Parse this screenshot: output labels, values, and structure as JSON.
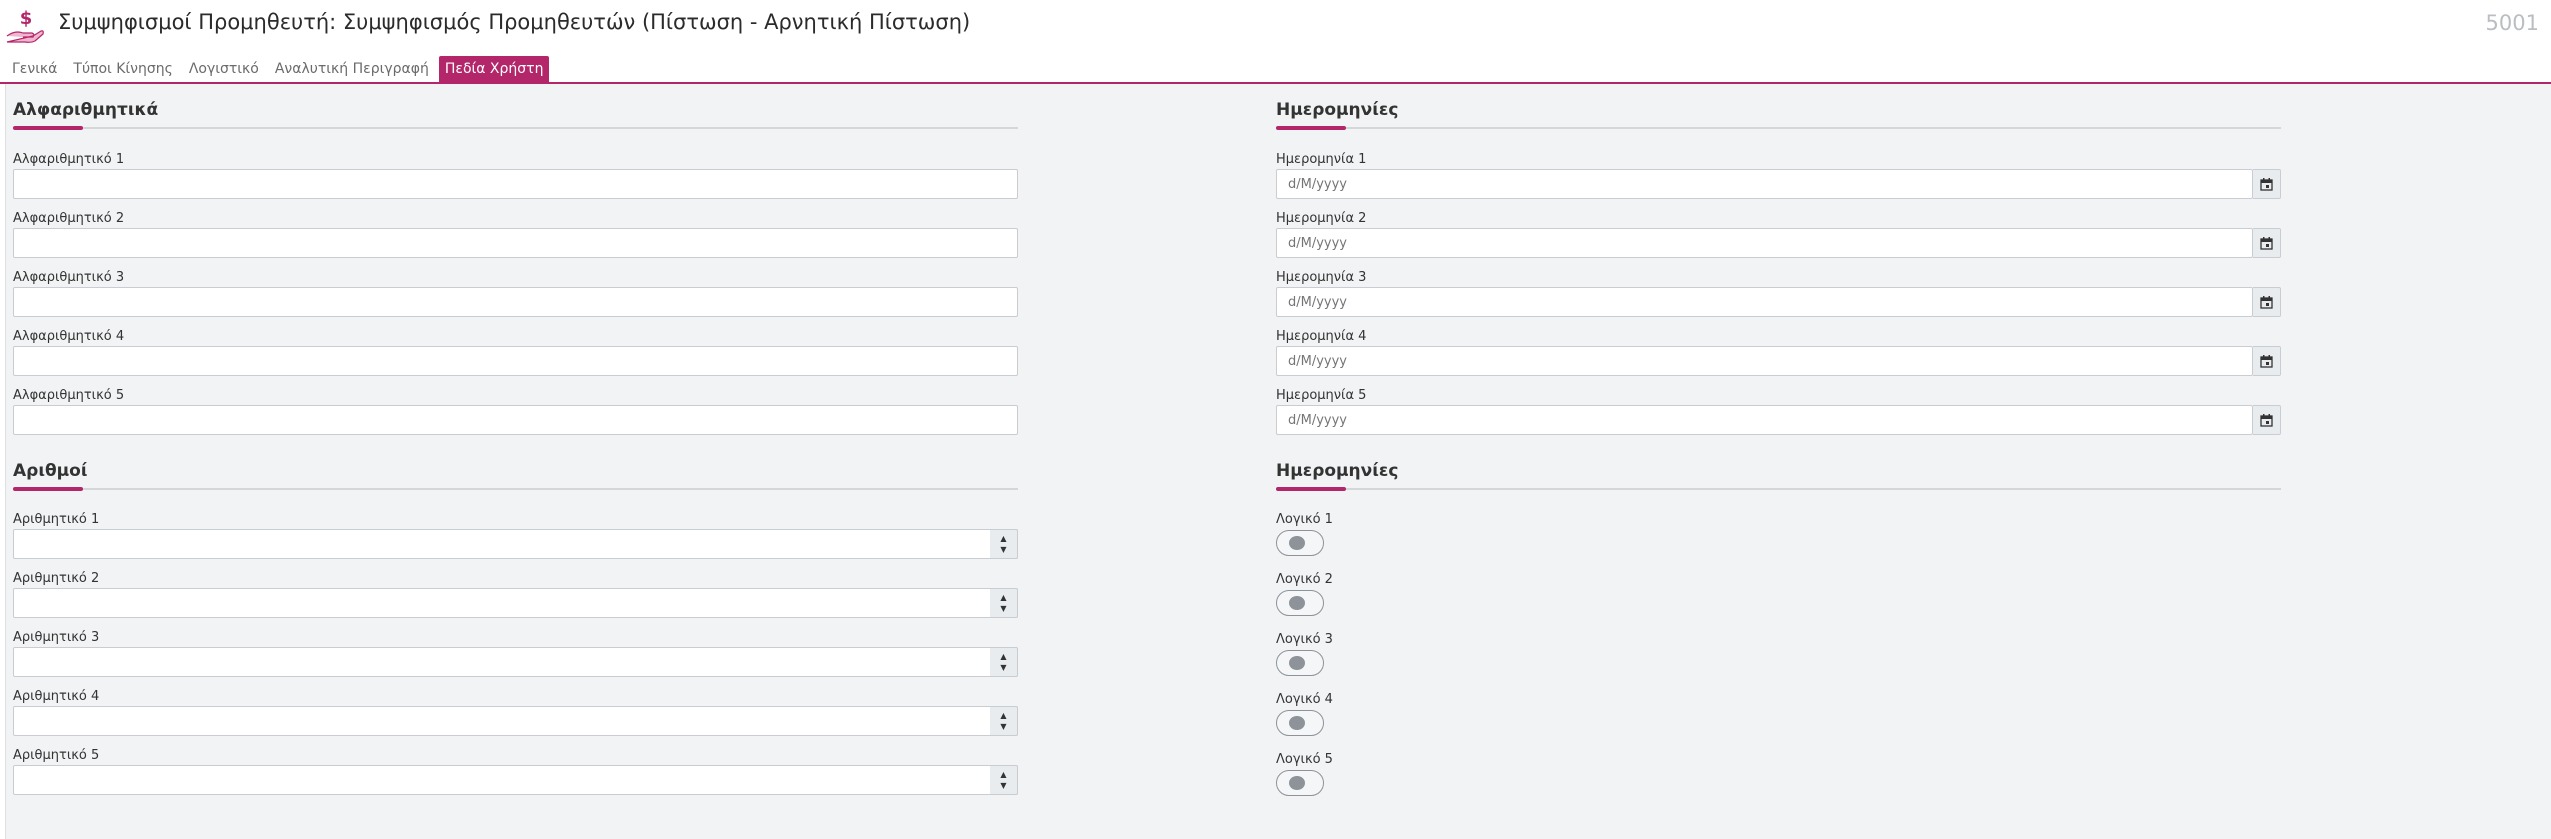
{
  "header": {
    "title": "Συμψηφισμοί Προμηθευτή: Συμψηφισμός Προμηθευτών (Πίστωση - Αρνητική Πίστωση)",
    "code": "5001",
    "icon": "hand-dollar-icon"
  },
  "tabs": [
    {
      "label": "Γενικά"
    },
    {
      "label": "Τύποι Κίνησης"
    },
    {
      "label": "Λογιστικό"
    },
    {
      "label": "Αναλυτική Περιγραφή"
    },
    {
      "label": "Πεδία Χρήστη",
      "active": true
    }
  ],
  "sections": {
    "alphanumeric": {
      "title": "Αλφαριθμητικά",
      "fields": [
        {
          "label": "Αλφαριθμητικό 1",
          "value": ""
        },
        {
          "label": "Αλφαριθμητικό 2",
          "value": ""
        },
        {
          "label": "Αλφαριθμητικό 3",
          "value": ""
        },
        {
          "label": "Αλφαριθμητικό 4",
          "value": ""
        },
        {
          "label": "Αλφαριθμητικό 5",
          "value": ""
        }
      ]
    },
    "dates": {
      "title": "Ημερομηνίες",
      "fields": [
        {
          "label": "Ημερομηνία 1",
          "placeholder": "d/M/yyyy"
        },
        {
          "label": "Ημερομηνία 2",
          "placeholder": "d/M/yyyy"
        },
        {
          "label": "Ημερομηνία 3",
          "placeholder": "d/M/yyyy"
        },
        {
          "label": "Ημερομηνία 4",
          "placeholder": "d/M/yyyy"
        },
        {
          "label": "Ημερομηνία 5",
          "placeholder": "d/M/yyyy"
        }
      ]
    },
    "numbers": {
      "title": "Αριθμοί",
      "fields": [
        {
          "label": "Αριθμητικό 1",
          "value": ""
        },
        {
          "label": "Αριθμητικό 2",
          "value": ""
        },
        {
          "label": "Αριθμητικό 3",
          "value": ""
        },
        {
          "label": "Αριθμητικό 4",
          "value": ""
        },
        {
          "label": "Αριθμητικό 5",
          "value": ""
        }
      ]
    },
    "booleans": {
      "title": "Ημερομηνίες",
      "fields": [
        {
          "label": "Λογικό 1",
          "checked": false
        },
        {
          "label": "Λογικό 2",
          "checked": false
        },
        {
          "label": "Λογικό 3",
          "checked": false
        },
        {
          "label": "Λογικό 4",
          "checked": false
        },
        {
          "label": "Λογικό 5",
          "checked": false
        }
      ]
    }
  },
  "colors": {
    "accent": "#b3266a",
    "background": "#f1f3f4"
  }
}
